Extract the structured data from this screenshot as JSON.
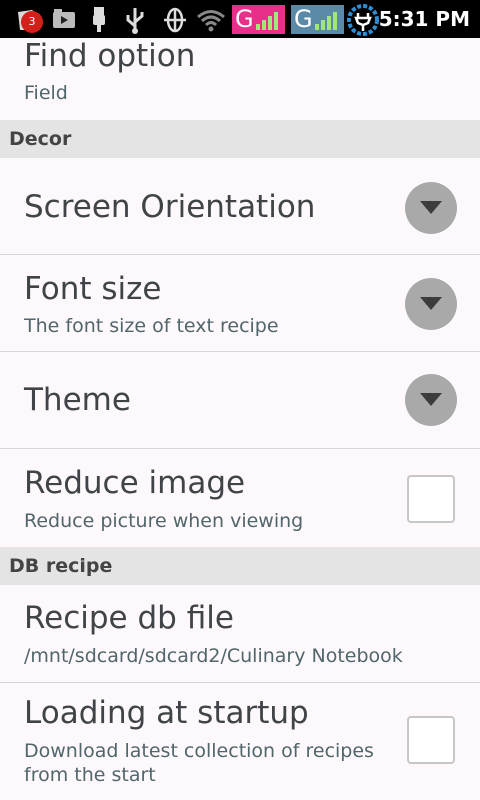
{
  "status_bar": {
    "notification_count": "3",
    "network_1": "G",
    "network_2": "G",
    "time": "5:31 PM",
    "icons": [
      "notification-icon",
      "media-icon",
      "usb-icon",
      "usb-debug-icon",
      "sync-icon",
      "wifi-icon",
      "battery-charging-icon"
    ]
  },
  "prefs": {
    "find_option": {
      "title": "Find option",
      "summary": "Field"
    },
    "decor_header": "Decor",
    "screen_orientation": {
      "title": "Screen Orientation"
    },
    "font_size": {
      "title": "Font size",
      "summary": "The font size of text recipe"
    },
    "theme": {
      "title": "Theme"
    },
    "reduce_image": {
      "title": "Reduce image",
      "summary": "Reduce picture when viewing",
      "checked": false
    },
    "db_header": "DB recipe",
    "recipe_db_file": {
      "title": "Recipe db file",
      "summary": "/mnt/sdcard/sdcard2/Culinary Notebook"
    },
    "loading_startup": {
      "title": "Loading at startup",
      "summary_line1": "Download latest collection of recipes",
      "summary_line2": "from the start",
      "checked": false
    }
  },
  "colors": {
    "background": "#fcf8fc",
    "section_bg": "#e4e4e4",
    "title_text": "#404448",
    "summary_text": "#51666a",
    "dropdown_bg": "#a9a9a9",
    "net1_bg": "#e8308a",
    "net2_bg": "#5b8aa8"
  }
}
